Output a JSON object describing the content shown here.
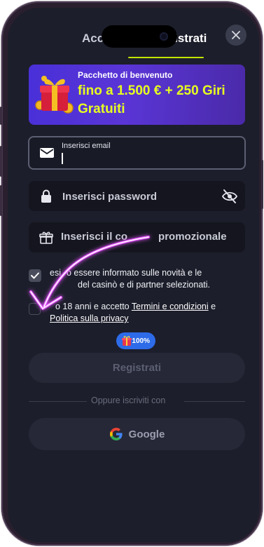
{
  "tabs": {
    "login": "Accedi",
    "register": "Registrati"
  },
  "banner": {
    "subtitle": "Pacchetto di benvenuto",
    "offer": "fino a 1.500 € + 250 Giri Gratuiti"
  },
  "email": {
    "label": "Inserisci email",
    "value": ""
  },
  "password": {
    "placeholder": "Inserisci password"
  },
  "promo": {
    "placeholder_a": "Inserisci il co",
    "placeholder_b": "promozionale"
  },
  "news_check": {
    "checked": true,
    "line1_a": "esi",
    "line1_b": "o essere informato sulle novità e le",
    "line2_a": "",
    "line2_b": "del casinò e di partner selezionati."
  },
  "terms_check": {
    "checked": false,
    "prefix": "o 18 anni e accetto",
    "terms_link": "Termini e condizioni",
    "joiner": "e",
    "privacy_link": "Politica sulla privacy"
  },
  "bonus_badge": {
    "value": "100%"
  },
  "register_button": "Registrati",
  "divider": "Oppure iscriviti con",
  "google_button": "Google",
  "colors": {
    "accent": "#c3e400",
    "banner": "#4f33d8",
    "annotation": "#e040ff",
    "badge": "#2d6be8"
  }
}
